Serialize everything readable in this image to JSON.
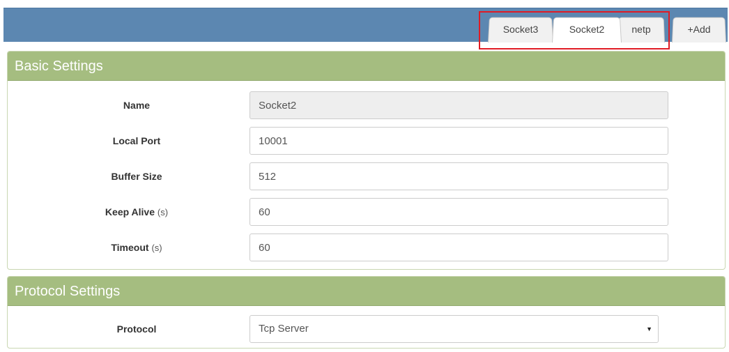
{
  "tabs": [
    {
      "label": "Socket3",
      "active": false
    },
    {
      "label": "Socket2",
      "active": true
    },
    {
      "label": "netp",
      "active": false
    },
    {
      "label": "+Add",
      "active": false
    }
  ],
  "basic_settings": {
    "title": "Basic Settings",
    "fields": {
      "name": {
        "label": "Name",
        "unit": "",
        "value": "Socket2",
        "readonly": true
      },
      "local_port": {
        "label": "Local Port",
        "unit": "",
        "value": "10001"
      },
      "buffer_size": {
        "label": "Buffer Size",
        "unit": "",
        "value": "512"
      },
      "keep_alive": {
        "label": "Keep Alive",
        "unit": "(s)",
        "value": "60"
      },
      "timeout": {
        "label": "Timeout",
        "unit": "(s)",
        "value": "60"
      }
    }
  },
  "protocol_settings": {
    "title": "Protocol Settings",
    "protocol": {
      "label": "Protocol",
      "selected": "Tcp Server"
    }
  },
  "colors": {
    "top_bar": "#5c87b1",
    "panel_header": "#a5bd80",
    "highlight": "#e01b24"
  },
  "icons": {
    "select_arrow": "caret-down-icon"
  }
}
